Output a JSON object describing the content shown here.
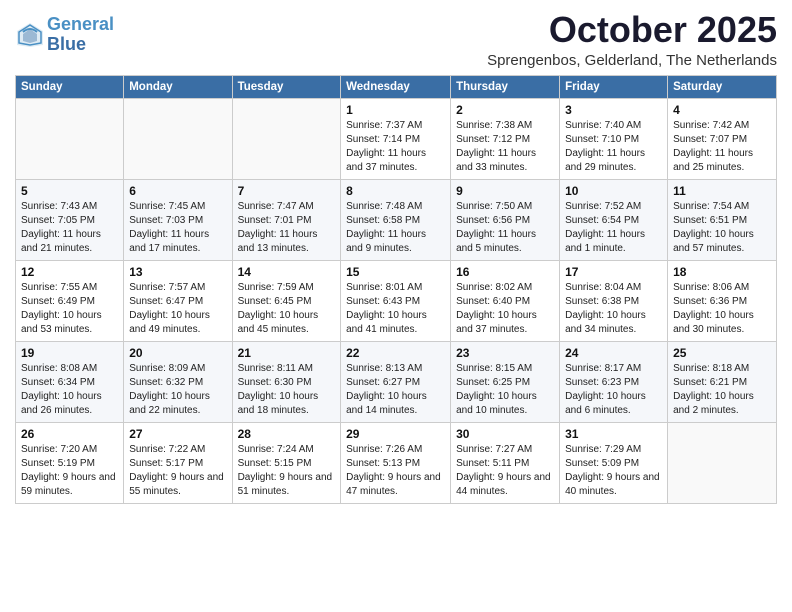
{
  "header": {
    "logo_line1": "General",
    "logo_line2": "Blue",
    "month": "October 2025",
    "location": "Sprengenbos, Gelderland, The Netherlands"
  },
  "weekdays": [
    "Sunday",
    "Monday",
    "Tuesday",
    "Wednesday",
    "Thursday",
    "Friday",
    "Saturday"
  ],
  "weeks": [
    [
      {
        "day": "",
        "info": ""
      },
      {
        "day": "",
        "info": ""
      },
      {
        "day": "",
        "info": ""
      },
      {
        "day": "1",
        "info": "Sunrise: 7:37 AM\nSunset: 7:14 PM\nDaylight: 11 hours and 37 minutes."
      },
      {
        "day": "2",
        "info": "Sunrise: 7:38 AM\nSunset: 7:12 PM\nDaylight: 11 hours and 33 minutes."
      },
      {
        "day": "3",
        "info": "Sunrise: 7:40 AM\nSunset: 7:10 PM\nDaylight: 11 hours and 29 minutes."
      },
      {
        "day": "4",
        "info": "Sunrise: 7:42 AM\nSunset: 7:07 PM\nDaylight: 11 hours and 25 minutes."
      }
    ],
    [
      {
        "day": "5",
        "info": "Sunrise: 7:43 AM\nSunset: 7:05 PM\nDaylight: 11 hours and 21 minutes."
      },
      {
        "day": "6",
        "info": "Sunrise: 7:45 AM\nSunset: 7:03 PM\nDaylight: 11 hours and 17 minutes."
      },
      {
        "day": "7",
        "info": "Sunrise: 7:47 AM\nSunset: 7:01 PM\nDaylight: 11 hours and 13 minutes."
      },
      {
        "day": "8",
        "info": "Sunrise: 7:48 AM\nSunset: 6:58 PM\nDaylight: 11 hours and 9 minutes."
      },
      {
        "day": "9",
        "info": "Sunrise: 7:50 AM\nSunset: 6:56 PM\nDaylight: 11 hours and 5 minutes."
      },
      {
        "day": "10",
        "info": "Sunrise: 7:52 AM\nSunset: 6:54 PM\nDaylight: 11 hours and 1 minute."
      },
      {
        "day": "11",
        "info": "Sunrise: 7:54 AM\nSunset: 6:51 PM\nDaylight: 10 hours and 57 minutes."
      }
    ],
    [
      {
        "day": "12",
        "info": "Sunrise: 7:55 AM\nSunset: 6:49 PM\nDaylight: 10 hours and 53 minutes."
      },
      {
        "day": "13",
        "info": "Sunrise: 7:57 AM\nSunset: 6:47 PM\nDaylight: 10 hours and 49 minutes."
      },
      {
        "day": "14",
        "info": "Sunrise: 7:59 AM\nSunset: 6:45 PM\nDaylight: 10 hours and 45 minutes."
      },
      {
        "day": "15",
        "info": "Sunrise: 8:01 AM\nSunset: 6:43 PM\nDaylight: 10 hours and 41 minutes."
      },
      {
        "day": "16",
        "info": "Sunrise: 8:02 AM\nSunset: 6:40 PM\nDaylight: 10 hours and 37 minutes."
      },
      {
        "day": "17",
        "info": "Sunrise: 8:04 AM\nSunset: 6:38 PM\nDaylight: 10 hours and 34 minutes."
      },
      {
        "day": "18",
        "info": "Sunrise: 8:06 AM\nSunset: 6:36 PM\nDaylight: 10 hours and 30 minutes."
      }
    ],
    [
      {
        "day": "19",
        "info": "Sunrise: 8:08 AM\nSunset: 6:34 PM\nDaylight: 10 hours and 26 minutes."
      },
      {
        "day": "20",
        "info": "Sunrise: 8:09 AM\nSunset: 6:32 PM\nDaylight: 10 hours and 22 minutes."
      },
      {
        "day": "21",
        "info": "Sunrise: 8:11 AM\nSunset: 6:30 PM\nDaylight: 10 hours and 18 minutes."
      },
      {
        "day": "22",
        "info": "Sunrise: 8:13 AM\nSunset: 6:27 PM\nDaylight: 10 hours and 14 minutes."
      },
      {
        "day": "23",
        "info": "Sunrise: 8:15 AM\nSunset: 6:25 PM\nDaylight: 10 hours and 10 minutes."
      },
      {
        "day": "24",
        "info": "Sunrise: 8:17 AM\nSunset: 6:23 PM\nDaylight: 10 hours and 6 minutes."
      },
      {
        "day": "25",
        "info": "Sunrise: 8:18 AM\nSunset: 6:21 PM\nDaylight: 10 hours and 2 minutes."
      }
    ],
    [
      {
        "day": "26",
        "info": "Sunrise: 7:20 AM\nSunset: 5:19 PM\nDaylight: 9 hours and 59 minutes."
      },
      {
        "day": "27",
        "info": "Sunrise: 7:22 AM\nSunset: 5:17 PM\nDaylight: 9 hours and 55 minutes."
      },
      {
        "day": "28",
        "info": "Sunrise: 7:24 AM\nSunset: 5:15 PM\nDaylight: 9 hours and 51 minutes."
      },
      {
        "day": "29",
        "info": "Sunrise: 7:26 AM\nSunset: 5:13 PM\nDaylight: 9 hours and 47 minutes."
      },
      {
        "day": "30",
        "info": "Sunrise: 7:27 AM\nSunset: 5:11 PM\nDaylight: 9 hours and 44 minutes."
      },
      {
        "day": "31",
        "info": "Sunrise: 7:29 AM\nSunset: 5:09 PM\nDaylight: 9 hours and 40 minutes."
      },
      {
        "day": "",
        "info": ""
      }
    ]
  ]
}
